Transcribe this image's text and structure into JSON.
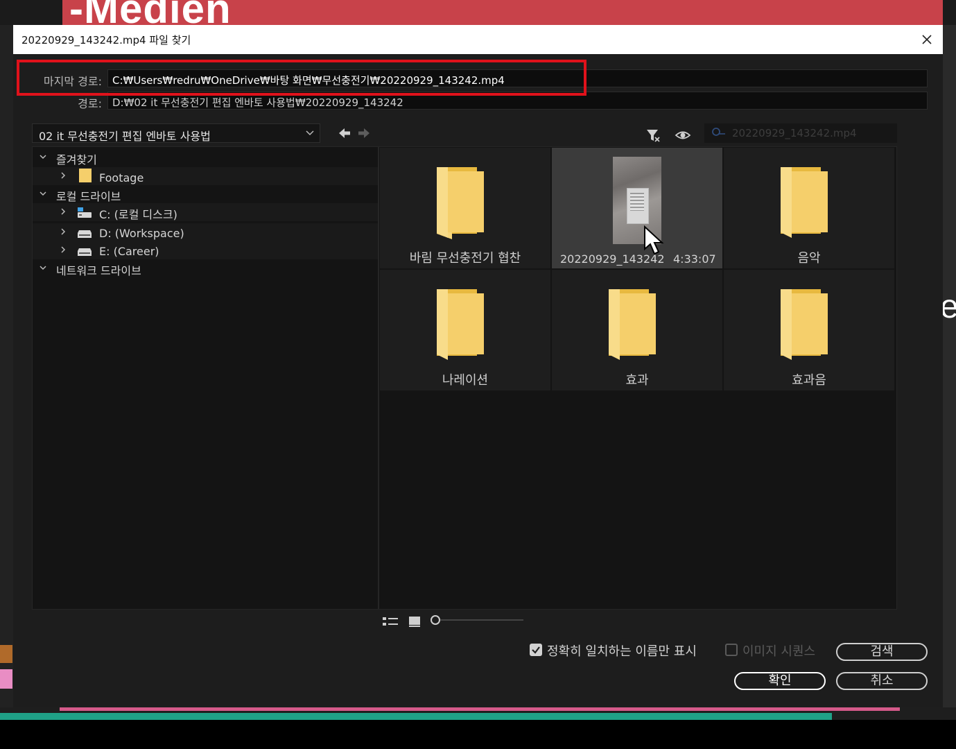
{
  "dialog": {
    "title": "20220929_143242.mp4 파일 찾기",
    "last_path_label": "마지막 경로:",
    "last_path_value": "C:₩Users₩redru₩OneDrive₩바탕 화면₩무선충전기₩20220929_143242.mp4",
    "path_label": "경로:",
    "path_value": "D:₩02 it 무선충전기 편집 엔바토 사용법₩20220929_143242"
  },
  "folder_select": {
    "value": "02 it 무선충전기 편집 엔바토 사용법"
  },
  "search": {
    "placeholder": "20220929_143242.mp4"
  },
  "tree": {
    "favorites": {
      "label": "즐겨찾기",
      "items": [
        {
          "label": "Footage"
        }
      ]
    },
    "local_drives": {
      "label": "로컬 드라이브",
      "items": [
        {
          "label": "C: (로컬 디스크)"
        },
        {
          "label": "D: (Workspace)"
        },
        {
          "label": "E: (Career)"
        }
      ]
    },
    "network_drives": {
      "label": "네트워크 드라이브"
    }
  },
  "grid": {
    "items": [
      {
        "type": "folder",
        "name": "바림 무선충전기 협찬"
      },
      {
        "type": "video",
        "name": "20220929_143242",
        "duration": "4:33:07"
      },
      {
        "type": "folder",
        "name": "음악"
      },
      {
        "type": "folder",
        "name": "나레이션"
      },
      {
        "type": "folder",
        "name": "효과"
      },
      {
        "type": "folder",
        "name": "효과음"
      }
    ]
  },
  "options": {
    "exact_match_label": "정확히 일치하는 이름만 표시",
    "exact_match_checked": true,
    "image_sequence_label": "이미지 시퀀스",
    "image_sequence_checked": false
  },
  "buttons": {
    "search": "검색",
    "ok": "확인",
    "cancel": "취소"
  },
  "background": {
    "headline": "-Medien",
    "side_letter": "e"
  },
  "colors": {
    "highlight": "#e0121b",
    "folder": "#f5cf6b",
    "bg_red": "#c8424a"
  }
}
